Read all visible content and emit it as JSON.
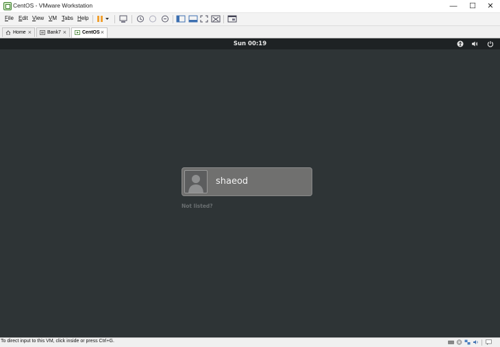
{
  "window": {
    "title": "CentOS - VMware Workstation"
  },
  "menu": [
    "File",
    "Edit",
    "View",
    "VM",
    "Tabs",
    "Help"
  ],
  "tabs": [
    {
      "label": "Home",
      "icon": "home-icon",
      "active": false
    },
    {
      "label": "Bank7",
      "icon": "vm-icon",
      "active": false
    },
    {
      "label": "CentOS",
      "icon": "vm-running-icon",
      "active": true
    }
  ],
  "vm": {
    "clock": "Sun 00:19",
    "user": {
      "name": "shaeod"
    },
    "not_listed": "Not listed?",
    "background_color": "#2e3436"
  },
  "status": {
    "message": "To direct input to this VM, click inside or press Ctrl+G."
  },
  "colors": {
    "pause_accent": "#f0a030",
    "vm_background": "#2e3436",
    "card": "#70706f"
  }
}
